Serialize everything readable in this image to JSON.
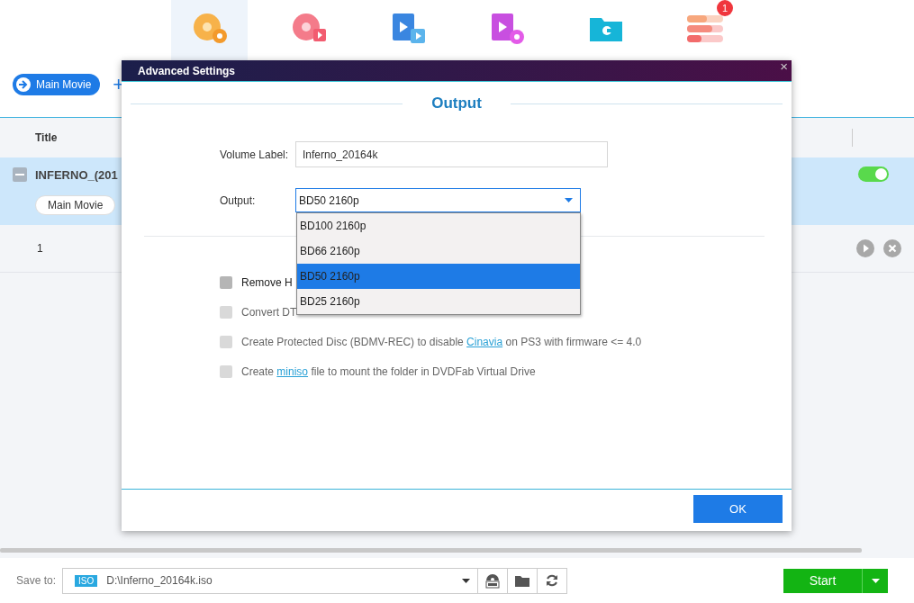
{
  "toolbar": {
    "items": [
      {
        "kind": "disc",
        "selected": true
      },
      {
        "kind": "disc-video",
        "selected": false
      },
      {
        "kind": "film",
        "selected": false
      },
      {
        "kind": "film-disc",
        "selected": false
      },
      {
        "kind": "folder",
        "selected": false
      },
      {
        "kind": "list",
        "selected": false,
        "badge": "1"
      }
    ]
  },
  "mode_button": "Main Movie",
  "add_button": "+",
  "table": {
    "column_title": "Title",
    "title_row": {
      "name": "INFERNO_(201",
      "chip": "Main Movie",
      "on": true
    },
    "rows": [
      {
        "number": "1"
      }
    ]
  },
  "dialog": {
    "title": "Advanced Settings",
    "close": "×",
    "heading": "Output",
    "volume_label": {
      "label": "Volume Label:",
      "value": "Inferno_20164k"
    },
    "output": {
      "label": "Output:",
      "value": "BD50 2160p",
      "options": [
        {
          "label": "BD100 2160p",
          "selected": false
        },
        {
          "label": "BD66 2160p",
          "selected": false
        },
        {
          "label": "BD50 2160p",
          "selected": true
        },
        {
          "label": "BD25 2160p",
          "selected": false
        }
      ]
    },
    "options": [
      {
        "before": "Remove H",
        "checked": false,
        "disabled": false
      },
      {
        "before": "Convert DT",
        "checked": false,
        "disabled": true
      },
      {
        "before": "Create Protected Disc (BDMV-REC) to disable ",
        "link": "Cinavia",
        "after": " on PS3 with firmware <= 4.0",
        "checked": false,
        "disabled": true
      },
      {
        "before": "Create ",
        "link": "miniso",
        "after": " file to mount the folder in DVDFab Virtual Drive",
        "checked": false,
        "disabled": true
      }
    ],
    "ok": "OK"
  },
  "bottom": {
    "save_label": "Save to:",
    "format": "ISO",
    "path": "D:\\Inferno_20164k.iso",
    "start": "Start"
  }
}
